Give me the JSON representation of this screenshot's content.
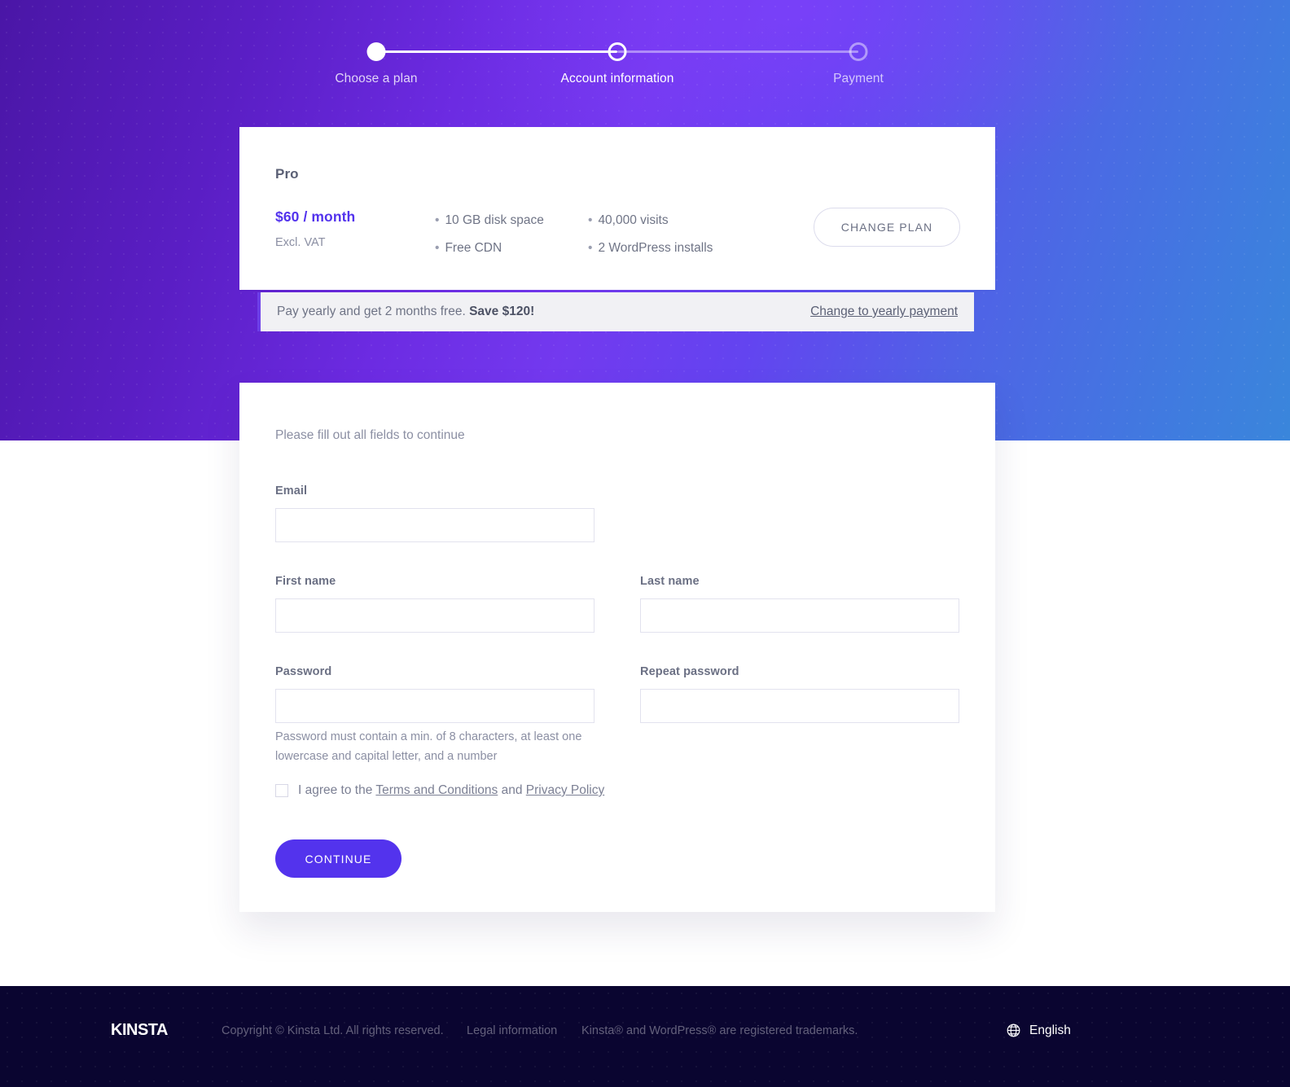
{
  "stepper": {
    "steps": [
      {
        "label": "Choose a plan",
        "state": "done"
      },
      {
        "label": "Account information",
        "state": "current"
      },
      {
        "label": "Payment",
        "state": "pending"
      }
    ]
  },
  "plan": {
    "name": "Pro",
    "price": "$60 / month",
    "vat_note": "Excl. VAT",
    "features_col1": [
      "10 GB disk space",
      "Free CDN"
    ],
    "features_col2": [
      "40,000 visits",
      "2 WordPress installs"
    ],
    "bullet": "•",
    "change_plan_label": "CHANGE PLAN"
  },
  "yearly_banner": {
    "text_lead": "Pay yearly and get 2 months free. ",
    "text_bold": "Save $120!",
    "link_label": "Change to yearly payment",
    "accent_color": "#6d3fe8"
  },
  "form": {
    "hint": "Please fill out all fields to continue",
    "fields": {
      "email": {
        "label": "Email",
        "value": "",
        "placeholder": ""
      },
      "first_name": {
        "label": "First name",
        "value": "",
        "placeholder": ""
      },
      "last_name": {
        "label": "Last name",
        "value": "",
        "placeholder": ""
      },
      "password": {
        "label": "Password",
        "value": "",
        "placeholder": ""
      },
      "repeat_password": {
        "label": "Repeat password",
        "value": "",
        "placeholder": ""
      }
    },
    "password_hint": "Password must contain a min. of 8 characters, at least one lowercase and capital letter, and a number",
    "agree": {
      "prefix": "I agree to the ",
      "terms_label": "Terms and Conditions",
      "joiner": " and ",
      "privacy_label": "Privacy Policy",
      "checked": false
    },
    "continue_label": "CONTINUE"
  },
  "footer": {
    "logo_text": "KINSTA",
    "copyright": "Copyright © Kinsta Ltd. All rights reserved.",
    "legal_label": "Legal information",
    "trademarks": "Kinsta® and WordPress® are registered trademarks.",
    "language": "English",
    "globe_icon": "globe-icon"
  },
  "colors": {
    "accent_purple": "#5333ed",
    "hero_start": "#4a16a6",
    "hero_mid": "#7339ef",
    "hero_end": "#3a86db",
    "footer_bg": "#0a0530"
  }
}
